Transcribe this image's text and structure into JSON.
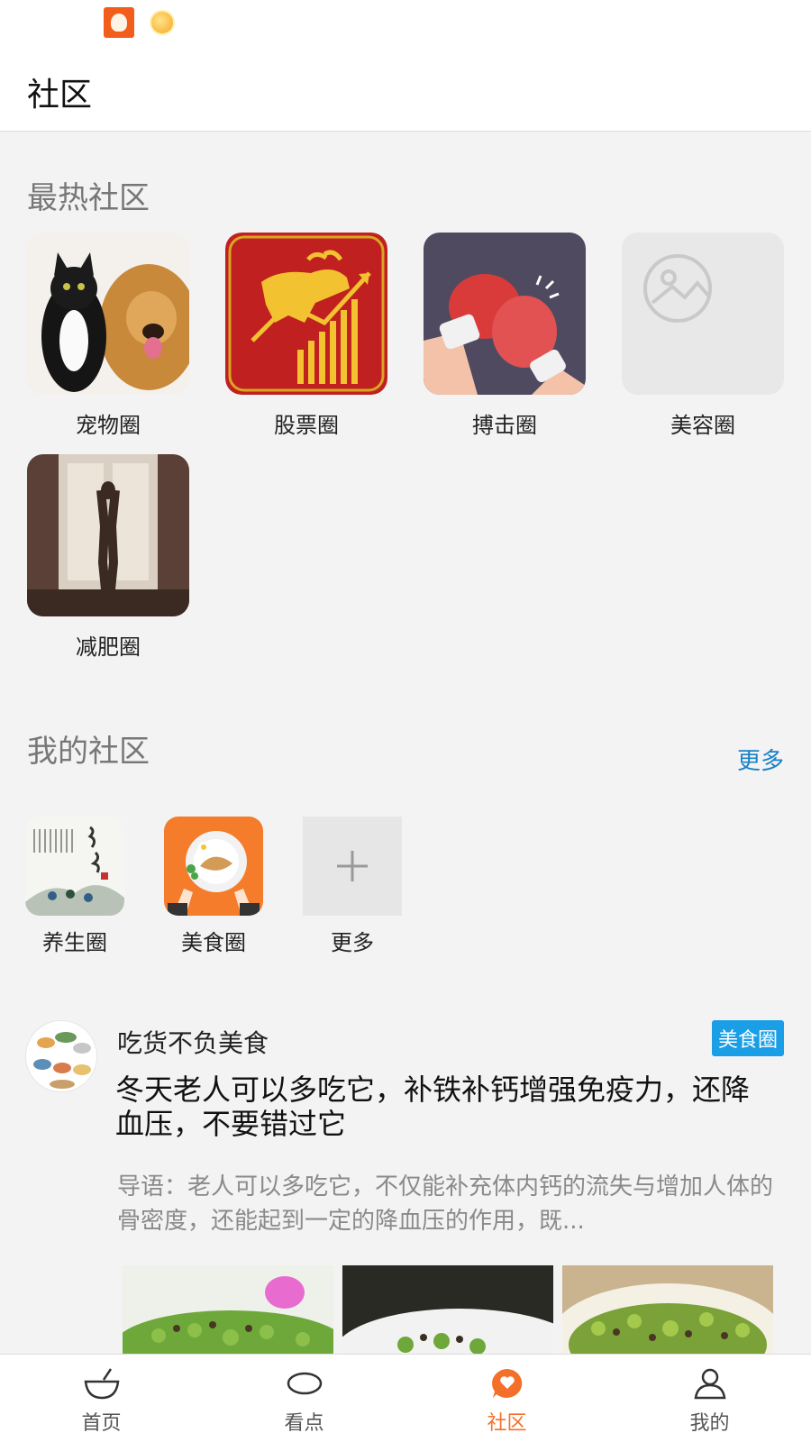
{
  "header": {
    "title": "社区"
  },
  "hot": {
    "title": "最热社区",
    "items": [
      {
        "label": "宠物圈",
        "icon": "pet-photo"
      },
      {
        "label": "股票圈",
        "icon": "bull-chart"
      },
      {
        "label": "搏击圈",
        "icon": "boxing-gloves"
      },
      {
        "label": "美容圈",
        "icon": "image-placeholder"
      },
      {
        "label": "减肥圈",
        "icon": "silhouette-photo"
      }
    ]
  },
  "mine": {
    "title": "我的社区",
    "more_label": "更多",
    "items": [
      {
        "label": "养生圈"
      },
      {
        "label": "美食圈"
      },
      {
        "label": "更多"
      }
    ]
  },
  "post": {
    "author": "吃货不负美食",
    "tag": "美食圈",
    "title": "冬天老人可以多吃它，补铁补钙增强免疫力，还降血压，不要错过它",
    "summary": "导语：老人可以多吃它，不仅能补充体内钙的流失与增加人体的骨密度，还能起到一定的降血压的作用，既..."
  },
  "tabs": [
    {
      "label": "首页",
      "icon": "bowl-icon"
    },
    {
      "label": "看点",
      "icon": "eye-icon"
    },
    {
      "label": "社区",
      "icon": "community-icon",
      "active": true
    },
    {
      "label": "我的",
      "icon": "person-icon"
    }
  ],
  "colors": {
    "accent": "#f4702a",
    "link": "#1a82c8",
    "tag": "#1a9ee6"
  }
}
